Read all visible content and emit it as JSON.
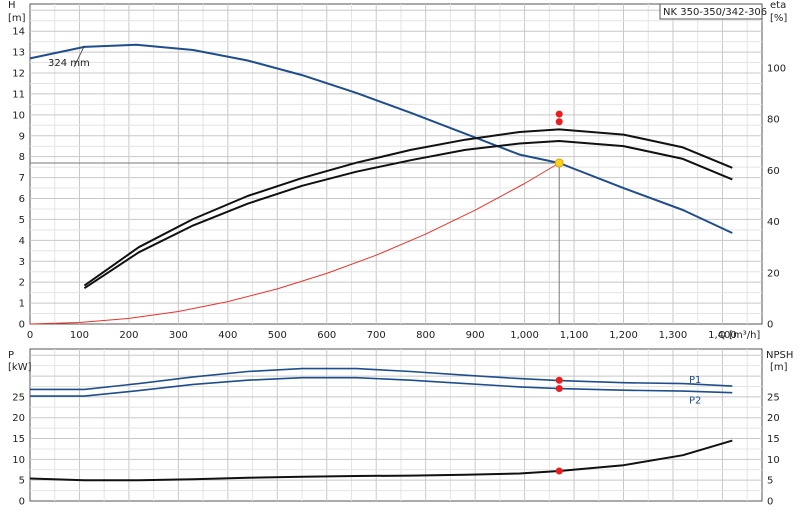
{
  "model_label": "NK 350-350/342-306",
  "chart_data": [
    {
      "type": "line",
      "panel": "head-efficiency",
      "xlabel": "Q [m³/h]",
      "x_ticks": [
        0,
        100,
        200,
        300,
        400,
        500,
        600,
        700,
        800,
        900,
        "1,000",
        "1,100",
        "1,200",
        "1,300",
        "1,400"
      ],
      "xlim": [
        0,
        1480
      ],
      "left_axis": {
        "label_line1": "H",
        "label_line2": "[m]",
        "ylim": [
          0,
          15.3
        ],
        "ticks": [
          0,
          1,
          2,
          3,
          4,
          5,
          6,
          7,
          8,
          9,
          10,
          11,
          12,
          13,
          14
        ]
      },
      "right_axis": {
        "label_line1": "eta",
        "label_line2": "[%]",
        "ylim": [
          0,
          125
        ],
        "ticks": [
          0,
          20,
          40,
          60,
          80,
          100
        ]
      },
      "grid": true,
      "annotation": "324 mm",
      "duty_point": {
        "x": 1070,
        "head": 7.7,
        "eta_values": [
          82,
          79
        ]
      },
      "series": [
        {
          "key": "head",
          "axis": "left",
          "x": [
            0,
            110,
            215,
            330,
            440,
            550,
            660,
            770,
            880,
            990,
            1070,
            1200,
            1320,
            1420
          ],
          "y": [
            12.7,
            13.25,
            13.35,
            13.1,
            12.6,
            11.9,
            11.05,
            10.1,
            9.1,
            8.1,
            7.7,
            6.5,
            5.45,
            4.35
          ],
          "color": "#1f4e8c"
        },
        {
          "key": "eta_a",
          "axis": "right",
          "x": [
            110,
            220,
            330,
            440,
            550,
            660,
            770,
            880,
            990,
            1070,
            1200,
            1320,
            1420
          ],
          "y": [
            15,
            30,
            41,
            50,
            57,
            63,
            68,
            72,
            75,
            76,
            74,
            69,
            61
          ],
          "color": "#111111"
        },
        {
          "key": "eta_b",
          "axis": "right",
          "x": [
            110,
            220,
            330,
            440,
            550,
            660,
            770,
            880,
            990,
            1070,
            1200,
            1320,
            1420
          ],
          "y": [
            14,
            28,
            38.5,
            47,
            54,
            59.5,
            64,
            68,
            70.5,
            71.5,
            69.5,
            64.5,
            56.5
          ],
          "color": "#111111"
        },
        {
          "key": "system",
          "axis": "left",
          "x": [
            0,
            100,
            200,
            300,
            400,
            500,
            600,
            700,
            800,
            900,
            1000,
            1070
          ],
          "y": [
            0,
            0.07,
            0.27,
            0.6,
            1.07,
            1.68,
            2.42,
            3.29,
            4.3,
            5.44,
            6.72,
            7.7
          ],
          "color": "#e8332a"
        }
      ]
    },
    {
      "type": "line",
      "panel": "power-npsh",
      "left_axis": {
        "label_line1": "P",
        "label_line2": "[kW]",
        "ylim": [
          0,
          36.5
        ],
        "ticks": [
          0,
          5,
          10,
          15,
          20,
          25
        ]
      },
      "right_axis": {
        "label_line1": "NPSH",
        "label_line2": "[m]",
        "ylim": [
          0,
          36.5
        ],
        "ticks": [
          0,
          5,
          10,
          15,
          20,
          25
        ]
      },
      "grid": true,
      "duty_markers": [
        29,
        27,
        7.2
      ],
      "series": [
        {
          "key": "P1",
          "name": "P1",
          "axis": "left",
          "x": [
            0,
            110,
            220,
            330,
            440,
            550,
            660,
            770,
            880,
            990,
            1070,
            1200,
            1320,
            1420
          ],
          "y": [
            26.8,
            26.8,
            28.2,
            29.8,
            31.1,
            31.8,
            31.8,
            31.1,
            30.2,
            29.4,
            28.9,
            28.4,
            28.2,
            27.6
          ],
          "color": "#1f4e8c"
        },
        {
          "key": "P2",
          "name": "P2",
          "axis": "left",
          "x": [
            0,
            110,
            220,
            330,
            440,
            550,
            660,
            770,
            880,
            990,
            1070,
            1200,
            1320,
            1420
          ],
          "y": [
            25.2,
            25.2,
            26.5,
            28.0,
            29.0,
            29.6,
            29.6,
            29.0,
            28.2,
            27.4,
            27.0,
            26.6,
            26.4,
            26.0
          ],
          "color": "#1f4e8c"
        },
        {
          "key": "NPSH",
          "axis": "right",
          "x": [
            0,
            110,
            220,
            330,
            440,
            550,
            660,
            770,
            880,
            990,
            1070,
            1200,
            1320,
            1420
          ],
          "y": [
            5.4,
            5.0,
            5.0,
            5.2,
            5.6,
            5.8,
            6.0,
            6.1,
            6.3,
            6.6,
            7.2,
            8.6,
            11.0,
            14.5
          ],
          "color": "#111111"
        }
      ]
    }
  ]
}
